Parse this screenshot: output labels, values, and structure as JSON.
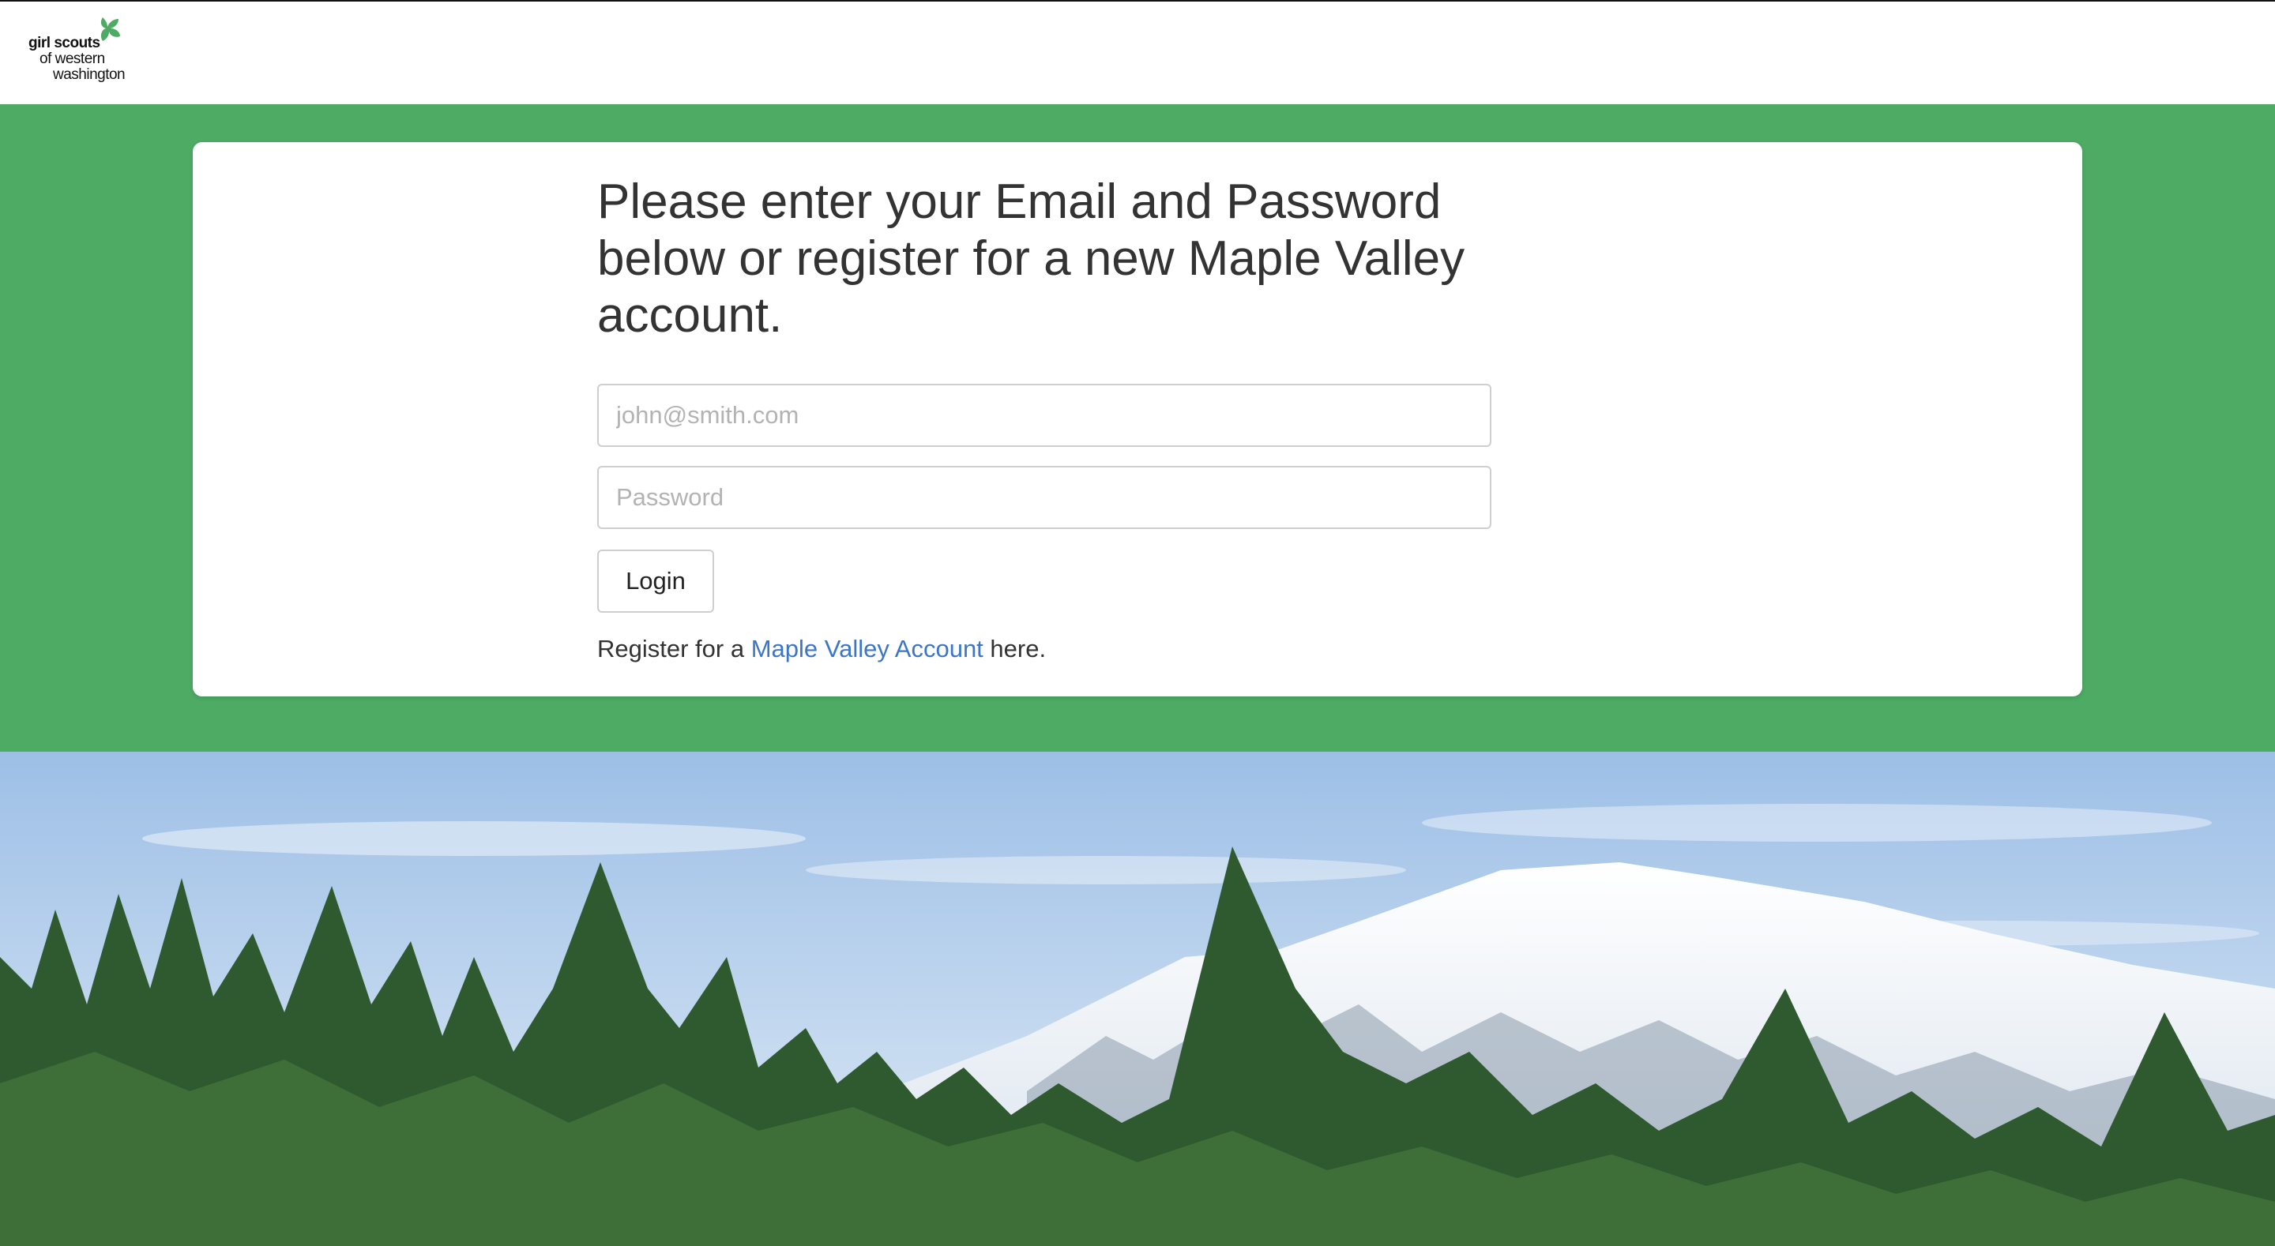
{
  "header": {
    "logo": {
      "line1": "girl scouts",
      "line2": "of western",
      "line3": "washington",
      "icon": "trefoil-icon"
    }
  },
  "login": {
    "heading": "Please enter your Email and Password below or register for a new Maple Valley account.",
    "email_placeholder": "john@smith.com",
    "email_value": "",
    "password_placeholder": "Password",
    "password_value": "",
    "login_label": "Login",
    "register_prefix": "Register for a ",
    "register_link": "Maple Valley Account",
    "register_suffix": " here."
  },
  "colors": {
    "band_green": "#4dab64",
    "link_blue": "#3b76c9",
    "heading_text": "#333333"
  },
  "hero": {
    "description": "mountain-landscape-image"
  }
}
